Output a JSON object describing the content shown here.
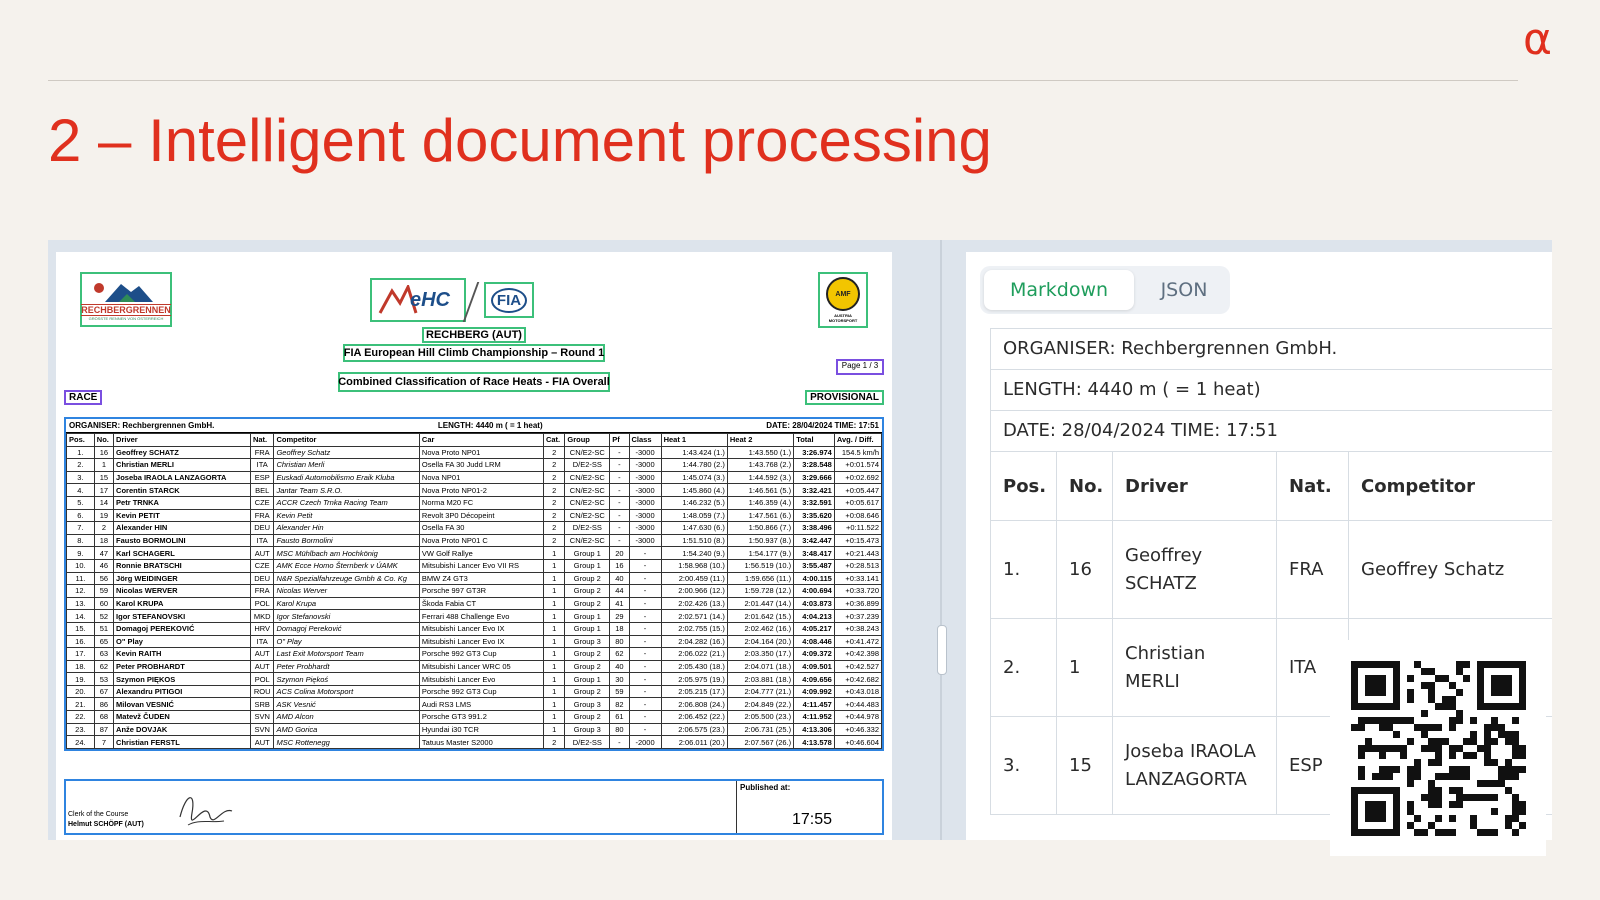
{
  "slide": {
    "title": "2 – Intelligent document processing",
    "logo_glyph": "α"
  },
  "document": {
    "logos": {
      "left_brand": "RECHBERGRENNEN",
      "left_sub": "GRÖSSTE RENNEN VON ÖSTERREICH",
      "center_left": "eHC",
      "center_right": "FIA",
      "right_top": "AMF",
      "right_bottom": "AUSTRIA MOTORSPORT"
    },
    "venue": "RECHBERG (AUT)",
    "championship": "FIA European Hill Climb Championship – Round 1",
    "classification": "Combined Classification of Race Heats - FIA Overall",
    "page": "Page 1 / 3",
    "race_tag": "RACE",
    "provisional_tag": "PROVISIONAL",
    "organiser": "ORGANISER: Rechbergrennen GmbH.",
    "length": "LENGTH: 4440 m ( = 1 heat)",
    "datetime": "DATE: 28/04/2024   TIME: 17:51",
    "columns": [
      "Pos.",
      "No.",
      "Driver",
      "Nat.",
      "Competitor",
      "Car",
      "Cat.",
      "Group",
      "Pf",
      "Class",
      "Heat 1",
      "Heat 2",
      "Total",
      "Avg. / Diff."
    ],
    "rows": [
      [
        "1.",
        "16",
        "Geoffrey SCHATZ",
        "FRA",
        "Geoffrey Schatz",
        "Nova Proto NP01",
        "2",
        "CN/E2-SC",
        "-",
        "-3000",
        "1:43.424  (1.)",
        "1:43.550  (1.)",
        "3:26.974",
        "154.5 km/h"
      ],
      [
        "2.",
        "1",
        "Christian MERLI",
        "ITA",
        "Christian Merli",
        "Osella FA 30 Judd LRM",
        "2",
        "D/E2-SS",
        "-",
        "-3000",
        "1:44.780  (2.)",
        "1:43.768  (2.)",
        "3:28.548",
        "+0:01.574"
      ],
      [
        "3.",
        "15",
        "Joseba IRAOLA LANZAGORTA",
        "ESP",
        "Euskadi Automobilismo Eraik Kluba",
        "Nova NP01",
        "2",
        "CN/E2-SC",
        "-",
        "-3000",
        "1:45.074  (3.)",
        "1:44.592  (3.)",
        "3:29.666",
        "+0:02.692"
      ],
      [
        "4.",
        "17",
        "Corentin STARCK",
        "BEL",
        "Jantar Team S.R.O.",
        "Nova Proto NP01-2",
        "2",
        "CN/E2-SC",
        "-",
        "-3000",
        "1:45.860  (4.)",
        "1:46.561  (5.)",
        "3:32.421",
        "+0:05.447"
      ],
      [
        "5.",
        "14",
        "Petr TRNKA",
        "CZE",
        "ACCR Czech Trnka Racing Team",
        "Norma M20 FC",
        "2",
        "CN/E2-SC",
        "-",
        "-3000",
        "1:46.232  (5.)",
        "1:46.359  (4.)",
        "3:32.591",
        "+0:05.617"
      ],
      [
        "6.",
        "19",
        "Kevin PETIT",
        "FRA",
        "Kevin Petit",
        "Revolt 3P0 Décopeint",
        "2",
        "CN/E2-SC",
        "-",
        "-3000",
        "1:48.059  (7.)",
        "1:47.561  (6.)",
        "3:35.620",
        "+0:08.646"
      ],
      [
        "7.",
        "2",
        "Alexander HIN",
        "DEU",
        "Alexander Hin",
        "Osella FA 30",
        "2",
        "D/E2-SS",
        "-",
        "-3000",
        "1:47.630  (6.)",
        "1:50.866  (7.)",
        "3:38.496",
        "+0:11.522"
      ],
      [
        "8.",
        "18",
        "Fausto BORMOLINI",
        "ITA",
        "Fausto Bormolini",
        "Nova Proto NP01 C",
        "2",
        "CN/E2-SC",
        "-",
        "-3000",
        "1:51.510  (8.)",
        "1:50.937  (8.)",
        "3:42.447",
        "+0:15.473"
      ],
      [
        "9.",
        "47",
        "Karl SCHAGERL",
        "AUT",
        "MSC Mühlbach am Hochkönig",
        "VW Golf Rallye",
        "1",
        "Group 1",
        "20",
        "-",
        "1:54.240  (9.)",
        "1:54.177  (9.)",
        "3:48.417",
        "+0:21.443"
      ],
      [
        "10.",
        "46",
        "Ronnie BRATSCHI",
        "CZE",
        "AMK Ecce Homo Šternberk v ÚAMK",
        "Mitsubishi Lancer Evo VII RS",
        "1",
        "Group 1",
        "16",
        "-",
        "1:58.968  (10.)",
        "1:56.519  (10.)",
        "3:55.487",
        "+0:28.513"
      ],
      [
        "11.",
        "56",
        "Jörg WEIDINGER",
        "DEU",
        "N&R Spezialfahrzeuge Gmbh & Co. Kg",
        "BMW Z4 GT3",
        "1",
        "Group 2",
        "40",
        "-",
        "2:00.459  (11.)",
        "1:59.656  (11.)",
        "4:00.115",
        "+0:33.141"
      ],
      [
        "12.",
        "59",
        "Nicolas WERVER",
        "FRA",
        "Nicolas Werver",
        "Porsche 997 GT3R",
        "1",
        "Group 2",
        "44",
        "-",
        "2:00.966  (12.)",
        "1:59.728  (12.)",
        "4:00.694",
        "+0:33.720"
      ],
      [
        "13.",
        "60",
        "Karol KRUPA",
        "POL",
        "Karol Krupa",
        "Škoda Fabia CT",
        "1",
        "Group 2",
        "41",
        "-",
        "2:02.426  (13.)",
        "2:01.447  (14.)",
        "4:03.873",
        "+0:36.899"
      ],
      [
        "14.",
        "52",
        "Igor STEFANOVSKI",
        "MKD",
        "Igor Stefanovski",
        "Ferrari 488 Challenge Evo",
        "1",
        "Group 1",
        "29",
        "-",
        "2:02.571  (14.)",
        "2:01.642  (15.)",
        "4:04.213",
        "+0:37.239"
      ],
      [
        "15.",
        "51",
        "Domagoj PEREKOVIĆ",
        "HRV",
        "Domagoj Pereković",
        "Mitsubishi Lancer Evo IX",
        "1",
        "Group 1",
        "18",
        "-",
        "2:02.755  (15.)",
        "2:02.462  (16.)",
        "4:05.217",
        "+0:38.243"
      ],
      [
        "16.",
        "65",
        "O\" Play",
        "ITA",
        "O\" Play",
        "Mitsubishi Lancer Evo IX",
        "1",
        "Group 3",
        "80",
        "-",
        "2:04.282  (16.)",
        "2:04.164  (20.)",
        "4:08.446",
        "+0:41.472"
      ],
      [
        "17.",
        "63",
        "Kevin RAITH",
        "AUT",
        "Last Exit Motorsport Team",
        "Porsche 992 GT3 Cup",
        "1",
        "Group 2",
        "62",
        "-",
        "2:06.022  (21.)",
        "2:03.350  (17.)",
        "4:09.372",
        "+0:42.398"
      ],
      [
        "18.",
        "62",
        "Peter PROBHARDT",
        "AUT",
        "Peter Probhardt",
        "Mitsubishi Lancer WRC 05",
        "1",
        "Group 2",
        "40",
        "-",
        "2:05.430  (18.)",
        "2:04.071  (18.)",
        "4:09.501",
        "+0:42.527"
      ],
      [
        "19.",
        "53",
        "Szymon PIĘKOS",
        "POL",
        "Szymon Piękoś",
        "Mitsubishi Lancer Evo",
        "1",
        "Group 1",
        "30",
        "-",
        "2:05.975  (19.)",
        "2:03.881  (18.)",
        "4:09.656",
        "+0:42.682"
      ],
      [
        "20.",
        "67",
        "Alexandru PITIGOI",
        "ROU",
        "ACS Colina Motorsport",
        "Porsche 992 GT3 Cup",
        "1",
        "Group 2",
        "59",
        "-",
        "2:05.215  (17.)",
        "2:04.777  (21.)",
        "4:09.992",
        "+0:43.018"
      ],
      [
        "21.",
        "86",
        "Milovan VESNIĆ",
        "SRB",
        "ASK Vesnić",
        "Audi RS3 LMS",
        "1",
        "Group 3",
        "82",
        "-",
        "2:06.808  (24.)",
        "2:04.849  (22.)",
        "4:11.457",
        "+0:44.483"
      ],
      [
        "22.",
        "68",
        "Matevž ČUDEN",
        "SVN",
        "AMD Alcon",
        "Porsche GT3 991.2",
        "1",
        "Group 2",
        "61",
        "-",
        "2:06.452  (22.)",
        "2:05.500  (23.)",
        "4:11.952",
        "+0:44.978"
      ],
      [
        "23.",
        "87",
        "Anže DOVJAK",
        "SVN",
        "AMD Gorica",
        "Hyundai i30 TCR",
        "1",
        "Group 3",
        "80",
        "-",
        "2:06.575  (23.)",
        "2:06.731  (25.)",
        "4:13.306",
        "+0:46.332"
      ],
      [
        "24.",
        "7",
        "Christian FERSTL",
        "AUT",
        "MSC Rottenegg",
        "Tatuus Master S2000",
        "2",
        "D/E2-SS",
        "-",
        "-2000",
        "2:06.011  (20.)",
        "2:07.567  (26.)",
        "4:13.578",
        "+0:46.604"
      ]
    ],
    "footer": {
      "clerk_label": "Clerk of the Course",
      "clerk_name": "Helmut SCHÖPF (AUT)",
      "published_label": "Published at:",
      "published_time": "17:55"
    }
  },
  "panel": {
    "tabs": [
      {
        "label": "Markdown",
        "active": true
      },
      {
        "label": "JSON",
        "active": false
      }
    ],
    "lines": [
      "ORGANISER: Rechbergrennen GmbH.",
      "LENGTH: 4440 m ( = 1 heat)",
      "DATE: 28/04/2024 TIME: 17:51"
    ],
    "headers": [
      "Pos.",
      "No.",
      "Driver",
      "Nat.",
      "Competitor"
    ],
    "rows": [
      [
        "1.",
        "16",
        "Geoffrey SCHATZ",
        "FRA",
        "Geoffrey Schatz"
      ],
      [
        "2.",
        "1",
        "Christian MERLI",
        "ITA",
        ""
      ],
      [
        "3.",
        "15",
        "Joseba IRAOLA LANZAGORTA",
        "ESP",
        ""
      ]
    ]
  },
  "colors": {
    "accent": "#e0301e",
    "active_tab": "#1f9d5c",
    "ocr_box_green": "#3cc07a",
    "ocr_box_blue": "#2f84e0",
    "ocr_box_purple": "#7a4fe0"
  }
}
